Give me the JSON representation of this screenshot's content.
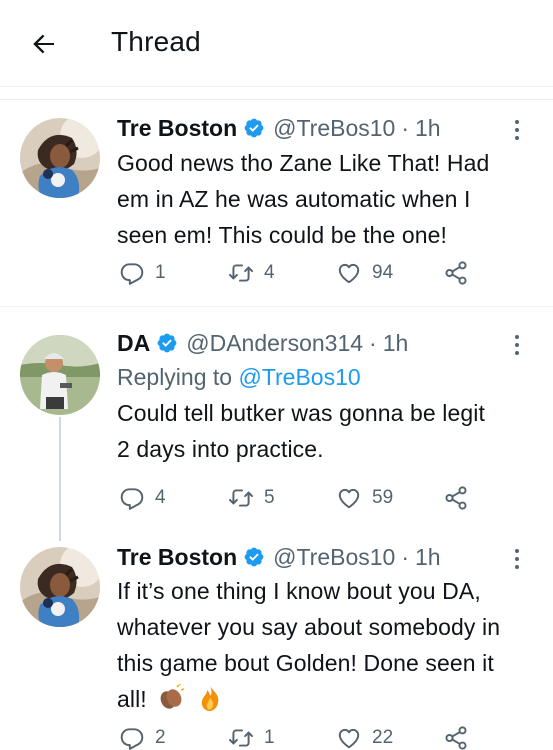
{
  "header": {
    "title": "Thread"
  },
  "tweets": [
    {
      "name": "Tre Boston",
      "handle": "@TreBos10",
      "separator": "·",
      "time": "1h",
      "lines": [
        "Good news tho Zane Like That! Had",
        "em in AZ he was automatic when I",
        "seen em! This could be the one!"
      ],
      "replies": "1",
      "retweets": "4",
      "likes": "94"
    },
    {
      "name": "DA",
      "handle": "@DAnderson314",
      "separator": "·",
      "time": "1h",
      "replying_prefix": "Replying to ",
      "replying_handle": "@TreBos10",
      "lines": [
        "Could tell butker was gonna be legit",
        "2 days into practice."
      ],
      "replies": "4",
      "retweets": "5",
      "likes": "59"
    },
    {
      "name": "Tre Boston",
      "handle": "@TreBos10",
      "separator": "·",
      "time": "1h",
      "lines": [
        "If it’s one thing I know bout you DA,",
        "whatever you say about somebody in",
        "this game bout Golden! Done seen it",
        "all!"
      ],
      "replies": "2",
      "retweets": "1",
      "likes": "22"
    }
  ],
  "icons": {
    "back": "arrow-left-icon",
    "verified": "verified-badge-icon",
    "reply": "reply-icon",
    "retweet": "retweet-icon",
    "like": "heart-icon",
    "share": "share-icon",
    "more": "more-icon",
    "clap": "clapping-hands-emoji",
    "fire": "fire-emoji"
  },
  "colors": {
    "text": "#0f1419",
    "secondary": "#536471",
    "accent": "#1d9bf0",
    "divider": "#eff3f4"
  }
}
